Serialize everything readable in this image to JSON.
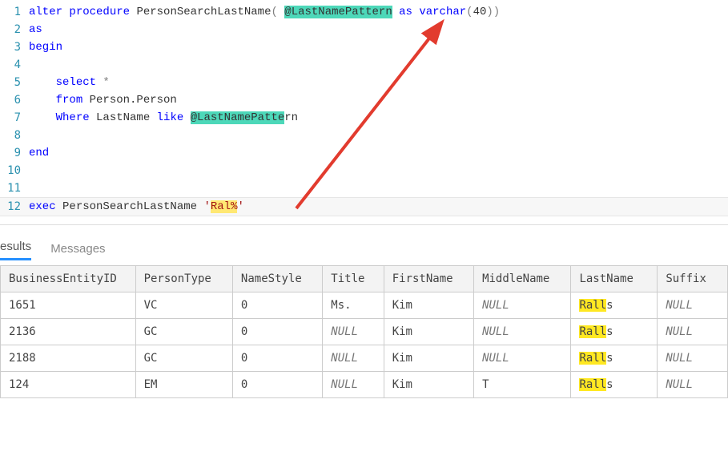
{
  "code": {
    "lines": [
      {
        "num": "1"
      },
      {
        "num": "2"
      },
      {
        "num": "3"
      },
      {
        "num": "4"
      },
      {
        "num": "5"
      },
      {
        "num": "6"
      },
      {
        "num": "7"
      },
      {
        "num": "8"
      },
      {
        "num": "9"
      },
      {
        "num": "10"
      },
      {
        "num": "11"
      },
      {
        "num": "12"
      }
    ],
    "tokens": {
      "alter": "alter",
      "procedure": "procedure",
      "proc_name": "PersonSearchLastName",
      "lparen": "(",
      "param": "@LastNamePattern",
      "as_kw": "as",
      "varchar": "varchar",
      "len_open": "(",
      "len_val": "40",
      "len_close": ")",
      "rparen": ")",
      "begin": "begin",
      "select": "select",
      "star": " *",
      "from": "from",
      "table": " Person.Person",
      "where": "Where",
      "col": " LastName ",
      "like": "like",
      "param_ref": "@LastNamePatte",
      "param_ref_tail": "rn",
      "end": "end",
      "exec": "exec",
      "exec_proc": " PersonSearchLastName ",
      "str_open": "'",
      "str_val": "Ral%",
      "str_close": "'"
    }
  },
  "tabs": {
    "results": "esults",
    "messages": "Messages"
  },
  "results": {
    "headers": {
      "beid": "BusinessEntityID",
      "ptype": "PersonType",
      "nstyle": "NameStyle",
      "title": "Title",
      "fname": "FirstName",
      "mname": "MiddleName",
      "lname": "LastName",
      "suffix": "Suffix"
    },
    "rows": [
      {
        "beid": "1651",
        "ptype": "VC",
        "nstyle": "0",
        "title": "Ms.",
        "fname": "Kim",
        "mname": "NULL",
        "lname_pre": "Rall",
        "lname_tail": "s",
        "suffix": "NULL",
        "title_null": false,
        "mname_null": true,
        "suffix_null": true
      },
      {
        "beid": "2136",
        "ptype": "GC",
        "nstyle": "0",
        "title": "NULL",
        "fname": "Kim",
        "mname": "NULL",
        "lname_pre": "Rall",
        "lname_tail": "s",
        "suffix": "NULL",
        "title_null": true,
        "mname_null": true,
        "suffix_null": true
      },
      {
        "beid": "2188",
        "ptype": "GC",
        "nstyle": "0",
        "title": "NULL",
        "fname": "Kim",
        "mname": "NULL",
        "lname_pre": "Rall",
        "lname_tail": "s",
        "suffix": "NULL",
        "title_null": true,
        "mname_null": true,
        "suffix_null": true
      },
      {
        "beid": "124",
        "ptype": "EM",
        "nstyle": "0",
        "title": "NULL",
        "fname": "Kim",
        "mname": "T",
        "lname_pre": "Rall",
        "lname_tail": "s",
        "suffix": "NULL",
        "title_null": true,
        "mname_null": false,
        "suffix_null": true
      }
    ]
  }
}
